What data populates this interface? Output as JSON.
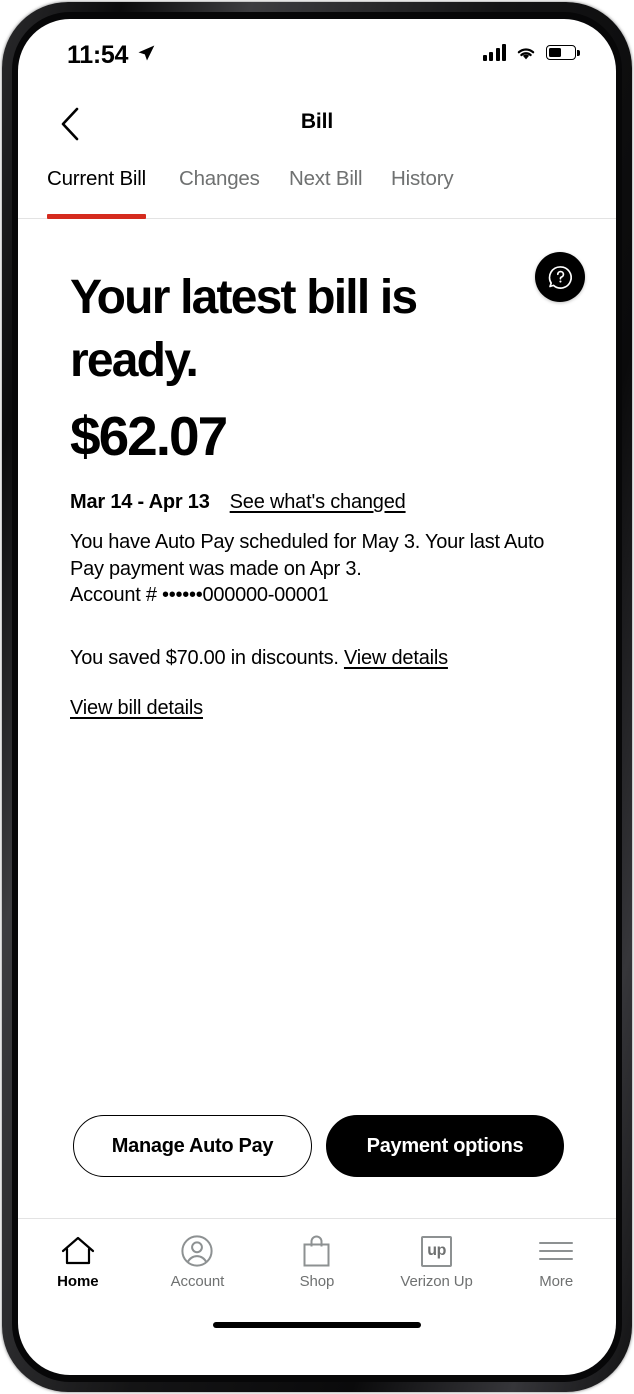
{
  "status_bar": {
    "time": "11:54",
    "location_icon": "location-arrow-icon",
    "signal_icon": "cellular-signal-icon",
    "wifi_icon": "wifi-icon",
    "battery_icon": "battery-icon",
    "battery_level_percent": 50
  },
  "header": {
    "back_icon": "chevron-left-icon",
    "title": "Bill"
  },
  "tabs": [
    {
      "label": "Current Bill",
      "active": true
    },
    {
      "label": "Changes",
      "active": false
    },
    {
      "label": "Next Bill",
      "active": false
    },
    {
      "label": "History",
      "active": false
    }
  ],
  "main": {
    "help_icon": "help-question-bubble-icon",
    "headline": "Your latest bill is ready.",
    "amount": "$62.07",
    "date_range": "Mar 14 - Apr 13",
    "see_changed_link": "See what's changed",
    "autopay_text": "You have Auto Pay scheduled for May 3. Your last Auto Pay payment was made on Apr 3.\nAccount # ••••••000000-00001",
    "savings_text": "You saved $70.00 in discounts.",
    "savings_link": "View details",
    "bill_details_link": "View bill details"
  },
  "actions": {
    "secondary_label": "Manage Auto Pay",
    "primary_label": "Payment options"
  },
  "bottom_nav": [
    {
      "label": "Home",
      "icon": "home-icon",
      "active": true
    },
    {
      "label": "Account",
      "icon": "account-person-icon",
      "active": false
    },
    {
      "label": "Shop",
      "icon": "shopping-bag-icon",
      "active": false
    },
    {
      "label": "Verizon Up",
      "icon": "verizon-up-icon",
      "badge_text": "up",
      "active": false
    },
    {
      "label": "More",
      "icon": "hamburger-menu-icon",
      "active": false
    }
  ],
  "colors": {
    "accent_red": "#d52b1e",
    "primary_black": "#000000",
    "muted_gray": "#6f7171",
    "divider": "#e3e3e3"
  }
}
